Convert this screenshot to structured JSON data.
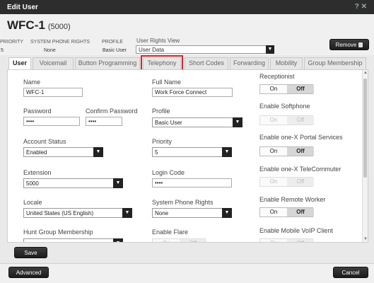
{
  "window": {
    "title": "Edit User",
    "help": "? ✕"
  },
  "user": {
    "name": "WFC-1",
    "extension_paren": "(5000)",
    "priority_label": "PRIORITY",
    "priority_value": "5",
    "rights_label": "SYSTEM PHONE RIGHTS",
    "rights_value": "None",
    "profile_label": "PROFILE",
    "profile_value": "Basic User",
    "rights_view_label": "User Rights View",
    "rights_view_value": "User Data"
  },
  "buttons": {
    "remove": "Remove",
    "save": "Save",
    "advanced": "Advanced",
    "cancel": "Cancel"
  },
  "tabs": [
    "User",
    "Voicemail",
    "Button Programming",
    "Telephony",
    "Short Codes",
    "Forwarding",
    "Mobility",
    "Group Membership"
  ],
  "form": {
    "name": {
      "label": "Name",
      "value": "WFC-1"
    },
    "full_name": {
      "label": "Full Name",
      "value": "Work Force Connect"
    },
    "password": {
      "label": "Password",
      "value": "••••"
    },
    "confirm_password": {
      "label": "Confirm Password",
      "value": "••••"
    },
    "profile": {
      "label": "Profile",
      "value": "Basic User"
    },
    "account_status": {
      "label": "Account Status",
      "value": "Enabled"
    },
    "priority": {
      "label": "Priority",
      "value": "5"
    },
    "extension": {
      "label": "Extension",
      "value": "5000"
    },
    "login_code": {
      "label": "Login Code",
      "value": "••••"
    },
    "locale": {
      "label": "Locale",
      "value": "United States (US English)"
    },
    "system_phone_rights": {
      "label": "System Phone Rights",
      "value": "None"
    },
    "hunt_group_membership": {
      "label": "Hunt Group Membership"
    },
    "enable_flare": {
      "label": "Enable Flare"
    }
  },
  "toggles": {
    "on_label": "On",
    "off_label": "Off",
    "receptionist": {
      "label": "Receptionist",
      "state": "off",
      "enabled": true
    },
    "enable_softphone": {
      "label": "Enable Softphone",
      "state": "off",
      "enabled": false
    },
    "enable_onex_portal": {
      "label": "Enable one-X Portal Services",
      "state": "off",
      "enabled": true
    },
    "enable_onex_telecommuter": {
      "label": "Enable one-X TeleCommuter",
      "state": "off",
      "enabled": false
    },
    "enable_remote_worker": {
      "label": "Enable Remote Worker",
      "state": "off",
      "enabled": true
    },
    "enable_mobile_voip": {
      "label": "Enable Mobile VoIP Client",
      "state": "off",
      "enabled": false
    }
  },
  "colors": {
    "highlight": "#d9252c",
    "dark_button": "#2a2a2a",
    "titlebar": "#2d2d2d"
  }
}
